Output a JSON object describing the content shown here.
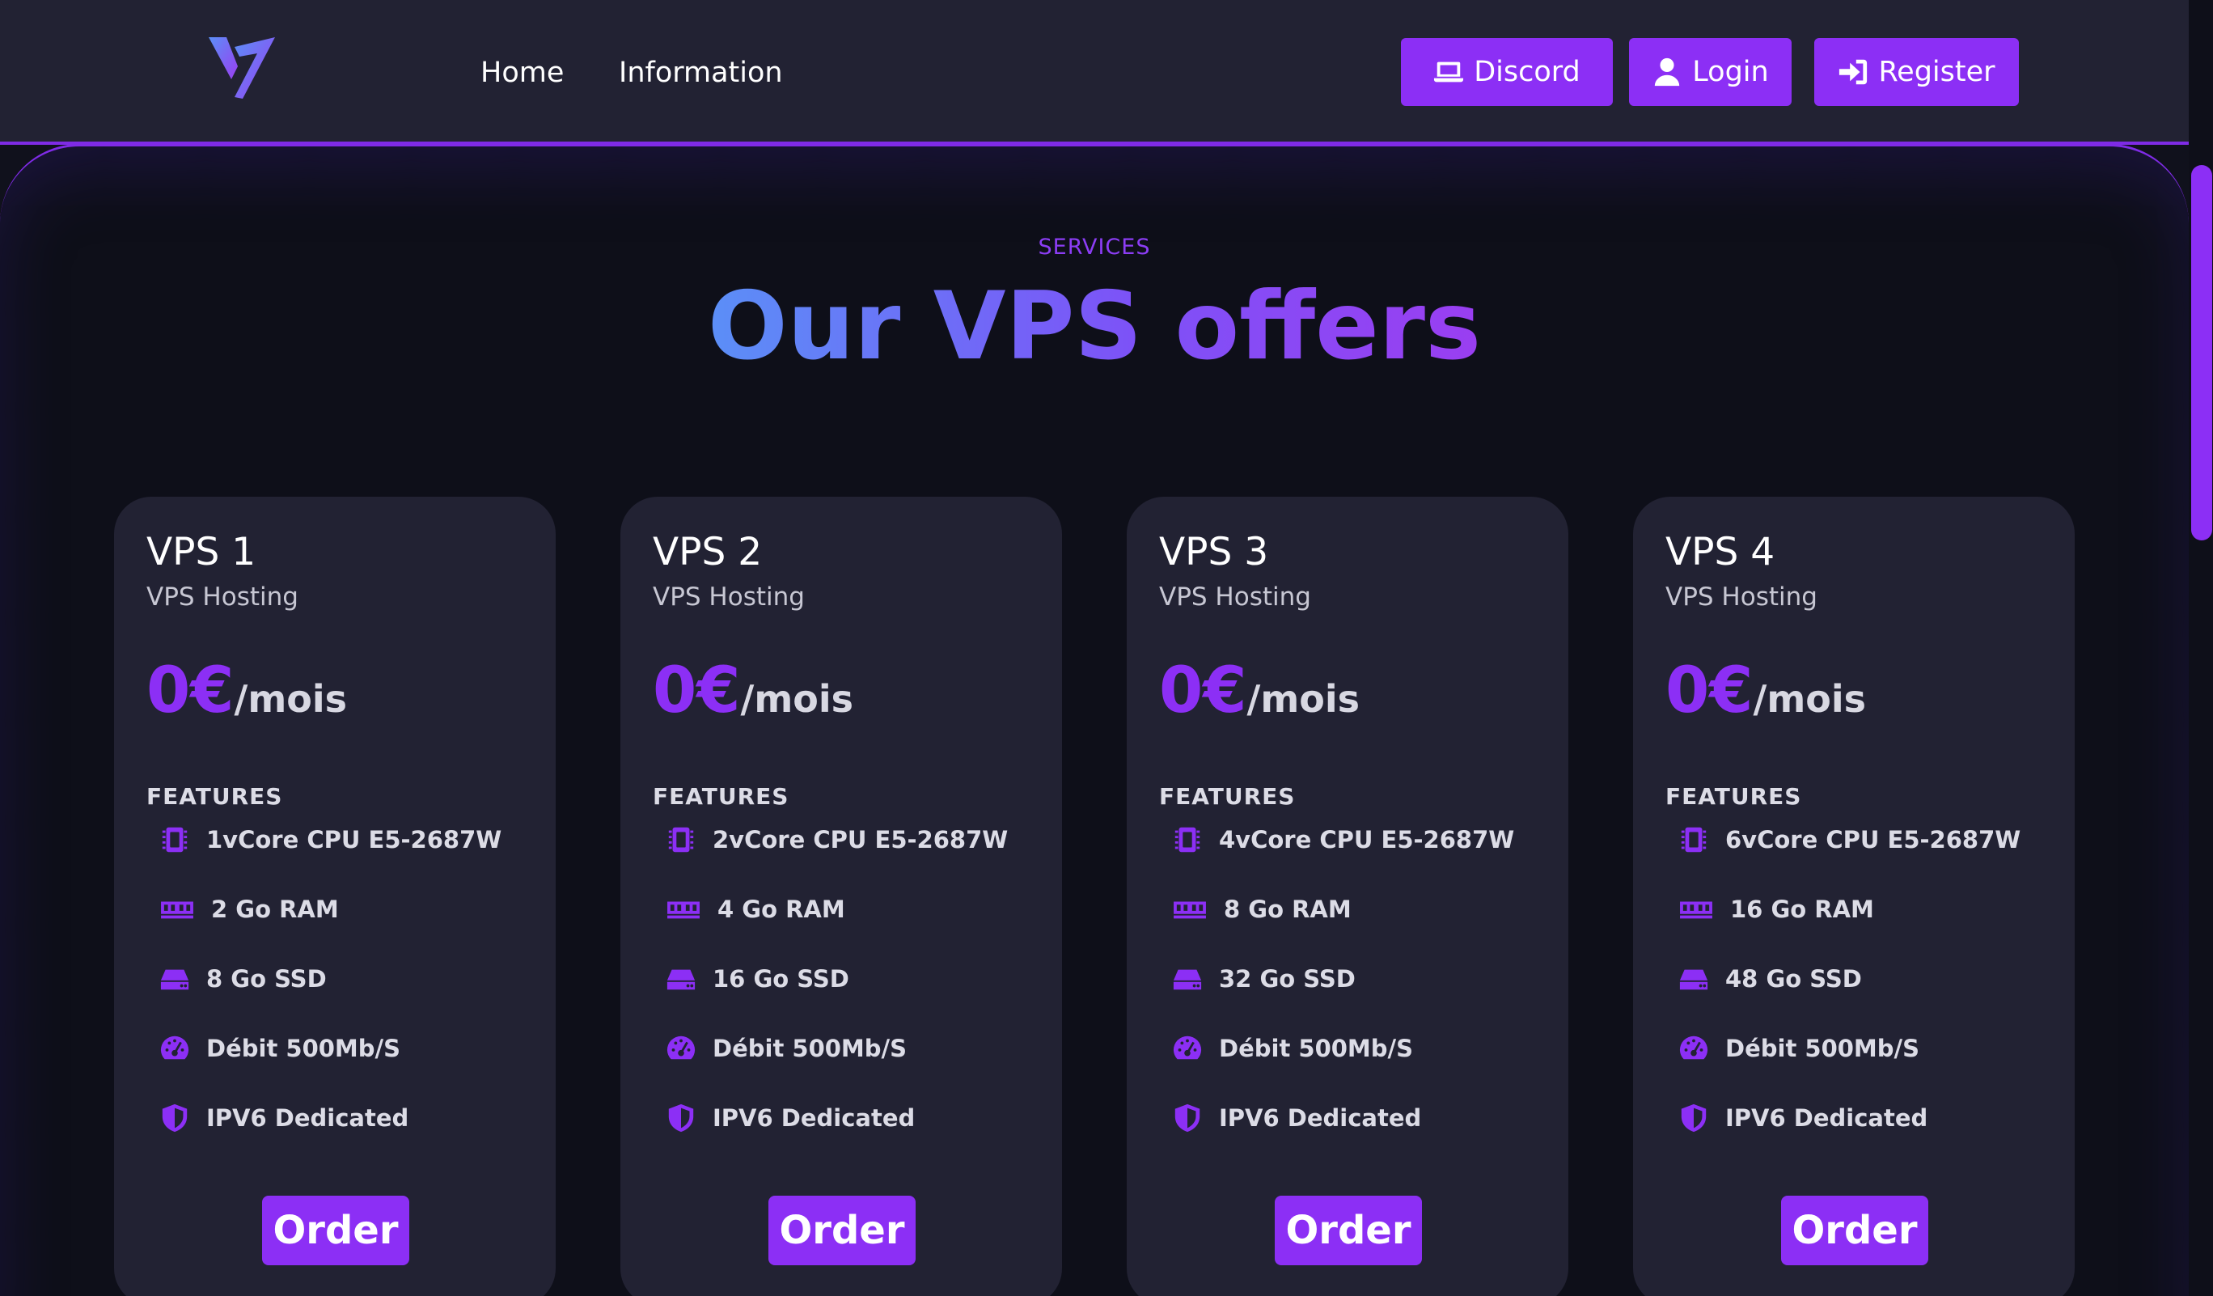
{
  "nav": {
    "links": [
      {
        "label": "Home"
      },
      {
        "label": "Information"
      }
    ],
    "buttons": [
      {
        "label": "Discord",
        "icon": "laptop-icon"
      },
      {
        "label": "Login",
        "icon": "user-icon"
      },
      {
        "label": "Register",
        "icon": "sign-in-icon"
      }
    ]
  },
  "hero": {
    "eyebrow": "SERVICES",
    "title": "Our VPS offers"
  },
  "colors": {
    "accent": "#8c2ff5",
    "background": "#0e0f19",
    "card": "#222233",
    "gradient_start": "#5b8ff7",
    "gradient_end": "#9a3ef1"
  },
  "plans": [
    {
      "name": "VPS 1",
      "subtitle": "VPS Hosting",
      "price": "0€",
      "unit": "/mois",
      "features_label": "FEATURES",
      "features": [
        {
          "icon": "cpu-icon",
          "text": "1vCore CPU E5-2687W"
        },
        {
          "icon": "memory-icon",
          "text": "2 Go RAM"
        },
        {
          "icon": "hdd-icon",
          "text": "8 Go SSD"
        },
        {
          "icon": "speedometer-icon",
          "text": "Débit 500Mb/S"
        },
        {
          "icon": "shield-icon",
          "text": "IPV6 Dedicated"
        }
      ],
      "button": "Order"
    },
    {
      "name": "VPS 2",
      "subtitle": "VPS Hosting",
      "price": "0€",
      "unit": "/mois",
      "features_label": "FEATURES",
      "features": [
        {
          "icon": "cpu-icon",
          "text": "2vCore CPU E5-2687W"
        },
        {
          "icon": "memory-icon",
          "text": "4 Go RAM"
        },
        {
          "icon": "hdd-icon",
          "text": "16 Go SSD"
        },
        {
          "icon": "speedometer-icon",
          "text": "Débit 500Mb/S"
        },
        {
          "icon": "shield-icon",
          "text": "IPV6 Dedicated"
        }
      ],
      "button": "Order"
    },
    {
      "name": "VPS 3",
      "subtitle": "VPS Hosting",
      "price": "0€",
      "unit": "/mois",
      "features_label": "FEATURES",
      "features": [
        {
          "icon": "cpu-icon",
          "text": "4vCore CPU E5-2687W"
        },
        {
          "icon": "memory-icon",
          "text": "8 Go RAM"
        },
        {
          "icon": "hdd-icon",
          "text": "32 Go SSD"
        },
        {
          "icon": "speedometer-icon",
          "text": "Débit 500Mb/S"
        },
        {
          "icon": "shield-icon",
          "text": "IPV6 Dedicated"
        }
      ],
      "button": "Order"
    },
    {
      "name": "VPS 4",
      "subtitle": "VPS Hosting",
      "price": "0€",
      "unit": "/mois",
      "features_label": "FEATURES",
      "features": [
        {
          "icon": "cpu-icon",
          "text": "6vCore CPU E5-2687W"
        },
        {
          "icon": "memory-icon",
          "text": "16 Go RAM"
        },
        {
          "icon": "hdd-icon",
          "text": "48 Go SSD"
        },
        {
          "icon": "speedometer-icon",
          "text": "Débit 500Mb/S"
        },
        {
          "icon": "shield-icon",
          "text": "IPV6 Dedicated"
        }
      ],
      "button": "Order"
    }
  ]
}
